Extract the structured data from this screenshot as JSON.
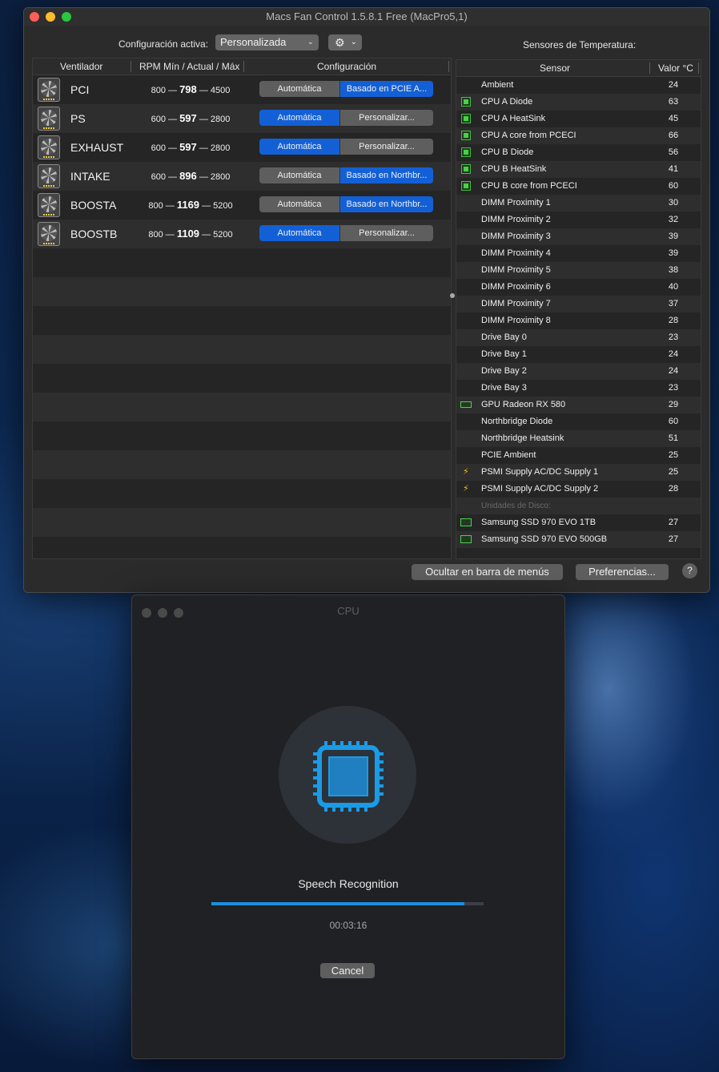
{
  "main_window": {
    "title": "Macs Fan Control 1.5.8.1 Free (MacPro5,1)",
    "config_label": "Configuración activa:",
    "config_value": "Personalizada",
    "sensors_label": "Sensores de Temperatura:",
    "fan_columns": [
      "Ventilador",
      "RPM Mín / Actual / Máx",
      "Configuración"
    ],
    "fans": [
      {
        "name": "PCI",
        "min": "800",
        "actual": "798",
        "max": "4500",
        "auto_label": "Automática",
        "custom_label": "Basado en PCIE A...",
        "mode": "custom"
      },
      {
        "name": "PS",
        "min": "600",
        "actual": "597",
        "max": "2800",
        "auto_label": "Automática",
        "custom_label": "Personalizar...",
        "mode": "auto"
      },
      {
        "name": "EXHAUST",
        "min": "600",
        "actual": "597",
        "max": "2800",
        "auto_label": "Automática",
        "custom_label": "Personalizar...",
        "mode": "auto"
      },
      {
        "name": "INTAKE",
        "min": "600",
        "actual": "896",
        "max": "2800",
        "auto_label": "Automática",
        "custom_label": "Basado en Northbr...",
        "mode": "custom"
      },
      {
        "name": "BOOSTA",
        "min": "800",
        "actual": "1169",
        "max": "5200",
        "auto_label": "Automática",
        "custom_label": "Basado en Northbr...",
        "mode": "custom"
      },
      {
        "name": "BOOSTB",
        "min": "800",
        "actual": "1109",
        "max": "5200",
        "auto_label": "Automática",
        "custom_label": "Personalizar...",
        "mode": "auto"
      }
    ],
    "rpm_separator": "—",
    "sensor_columns": [
      "Sensor",
      "Valor °C"
    ],
    "sensors": [
      {
        "name": "Ambient",
        "value": "24",
        "icon": "none"
      },
      {
        "name": "CPU A Diode",
        "value": "63",
        "icon": "chip"
      },
      {
        "name": "CPU A HeatSink",
        "value": "45",
        "icon": "chip"
      },
      {
        "name": "CPU A core from PCECI",
        "value": "66",
        "icon": "chip"
      },
      {
        "name": "CPU B Diode",
        "value": "56",
        "icon": "chip"
      },
      {
        "name": "CPU B HeatSink",
        "value": "41",
        "icon": "chip"
      },
      {
        "name": "CPU B core from PCECI",
        "value": "60",
        "icon": "chip"
      },
      {
        "name": "DIMM Proximity 1",
        "value": "30",
        "icon": "none"
      },
      {
        "name": "DIMM Proximity 2",
        "value": "32",
        "icon": "none"
      },
      {
        "name": "DIMM Proximity 3",
        "value": "39",
        "icon": "none"
      },
      {
        "name": "DIMM Proximity 4",
        "value": "39",
        "icon": "none"
      },
      {
        "name": "DIMM Proximity 5",
        "value": "38",
        "icon": "none"
      },
      {
        "name": "DIMM Proximity 6",
        "value": "40",
        "icon": "none"
      },
      {
        "name": "DIMM Proximity 7",
        "value": "37",
        "icon": "none"
      },
      {
        "name": "DIMM Proximity 8",
        "value": "28",
        "icon": "none"
      },
      {
        "name": "Drive Bay 0",
        "value": "23",
        "icon": "none"
      },
      {
        "name": "Drive Bay 1",
        "value": "24",
        "icon": "none"
      },
      {
        "name": "Drive Bay 2",
        "value": "24",
        "icon": "none"
      },
      {
        "name": "Drive Bay 3",
        "value": "23",
        "icon": "none"
      },
      {
        "name": "GPU Radeon RX 580",
        "value": "29",
        "icon": "gpu"
      },
      {
        "name": "Northbridge Diode",
        "value": "60",
        "icon": "none"
      },
      {
        "name": "Northbridge Heatsink",
        "value": "51",
        "icon": "none"
      },
      {
        "name": "PCIE Ambient",
        "value": "25",
        "icon": "none"
      },
      {
        "name": "PSMI Supply AC/DC Supply 1",
        "value": "25",
        "icon": "bolt"
      },
      {
        "name": "PSMI Supply AC/DC Supply 2",
        "value": "28",
        "icon": "bolt"
      },
      {
        "name": "Unidades de Disco:",
        "value": "",
        "icon": "group"
      },
      {
        "name": "Samsung SSD 970 EVO 1TB",
        "value": "27",
        "icon": "ssd"
      },
      {
        "name": "Samsung SSD 970 EVO 500GB",
        "value": "27",
        "icon": "ssd"
      }
    ],
    "hide_button": "Ocultar en barra de menús",
    "prefs_button": "Preferencias...",
    "help_button": "?"
  },
  "cpu_window": {
    "title": "CPU",
    "task": "Speech Recognition",
    "progress": 0.93,
    "elapsed": "00:03:16",
    "cancel": "Cancel"
  },
  "colors": {
    "accent": "#1360d6",
    "progress": "#1c8fe0",
    "window_bg": "#2b2b2b"
  }
}
